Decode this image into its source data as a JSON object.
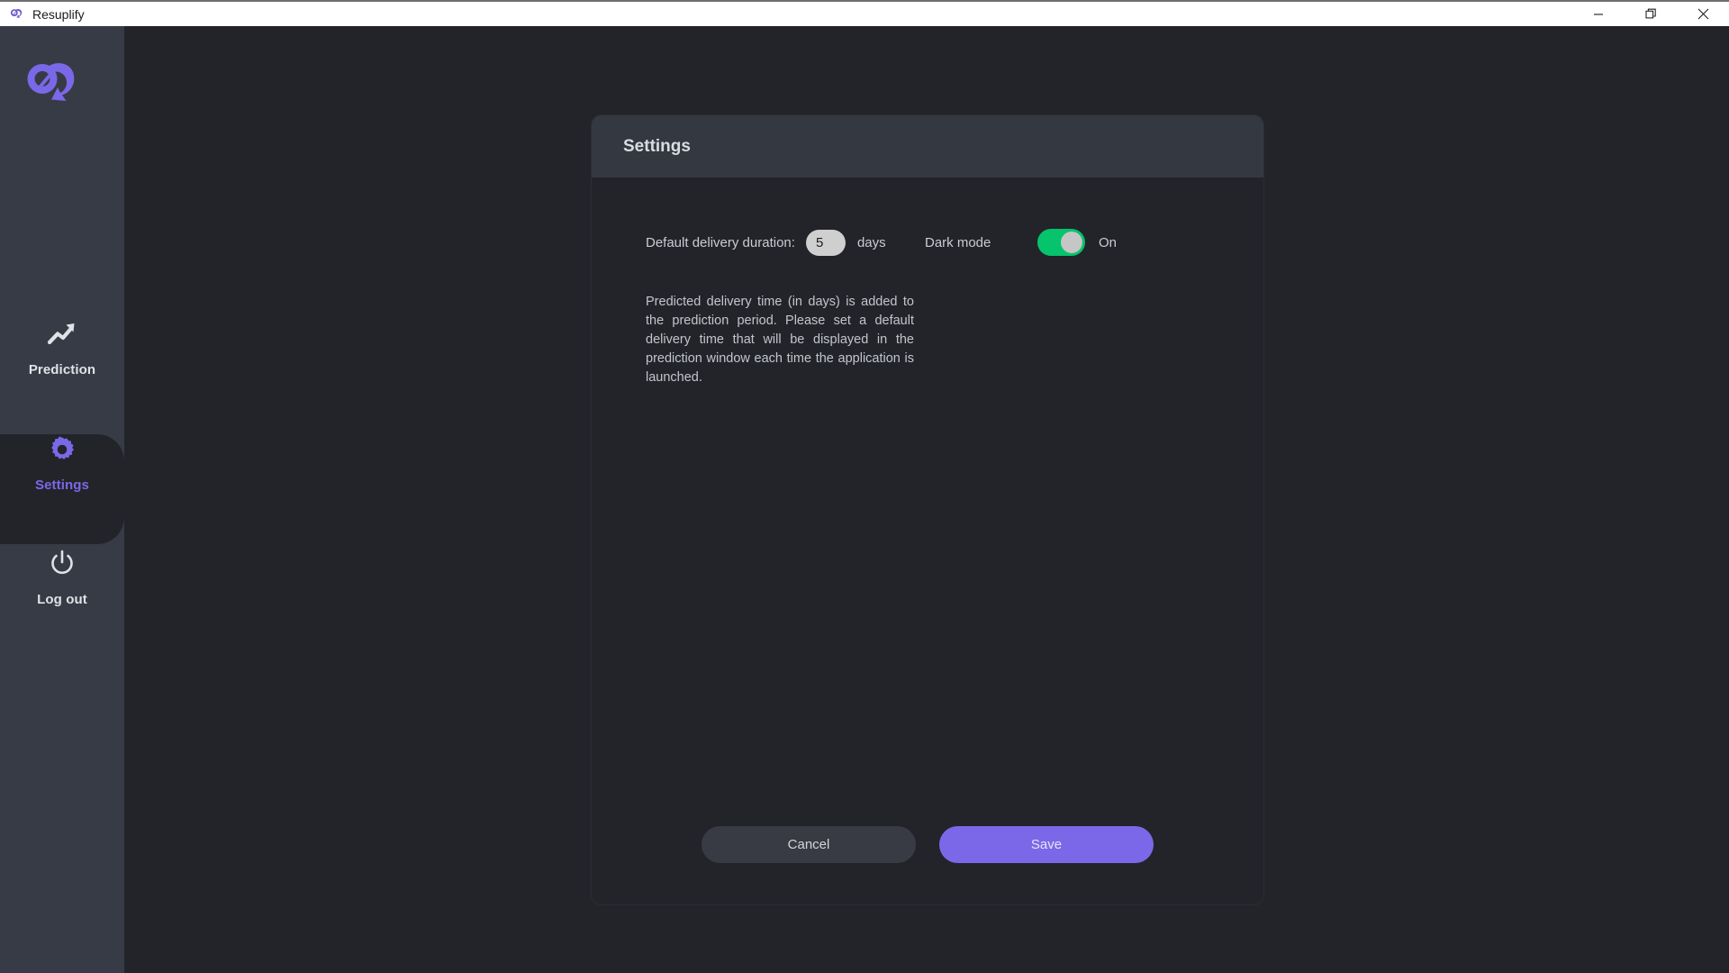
{
  "window": {
    "app_name": "Resuplify",
    "logo_icon": "resuplify-loop-logo-icon",
    "controls": [
      {
        "name": "minimize-button",
        "icon": "minimize-icon",
        "label": "Minimize"
      },
      {
        "name": "maximize-button",
        "icon": "restore-window-icon",
        "label": "Restore"
      },
      {
        "name": "close-button",
        "icon": "close-icon",
        "label": "Close"
      }
    ]
  },
  "sidebar": {
    "brand_logo_icon": "resuplify-loop-logo-icon",
    "items": [
      {
        "id": "prediction",
        "label": "Prediction",
        "icon": "trending-up-icon",
        "active": false
      },
      {
        "id": "settings",
        "label": "Settings",
        "icon": "gear-icon",
        "active": true
      },
      {
        "id": "logout",
        "label": "Log out",
        "icon": "power-icon",
        "active": false
      }
    ]
  },
  "card": {
    "title": "Settings",
    "duration": {
      "label": "Default delivery duration:",
      "value": "5",
      "placeholder": "5",
      "unit": "days"
    },
    "dark_mode": {
      "label": "Dark mode",
      "state": "On",
      "enabled": true
    },
    "description": "Predicted delivery time (in days) is added to the prediction period. Please set a default delivery time that will be displayed in the prediction window each time the application is launched.",
    "footer": {
      "cancel_label": "Cancel",
      "save_label": "Save"
    }
  },
  "colors": {
    "accent_purple": "#7b68e8",
    "toggle_green": "#05c46b",
    "sidebar_bg": "#373b45",
    "app_bg": "#222429",
    "card_header_bg": "#343841"
  }
}
